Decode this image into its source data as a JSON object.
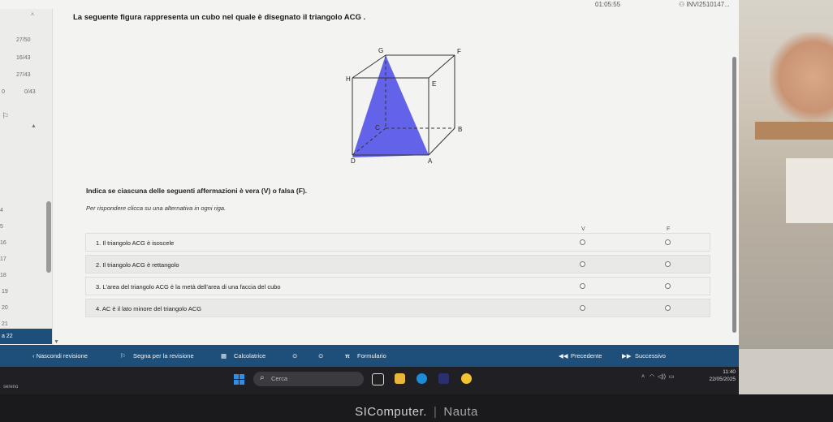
{
  "topbar": {
    "timer": "01:05:55",
    "user_id": "⚇ INVI2510147..."
  },
  "question": {
    "text": "La seguente figura rappresenta un cubo nel quale è disegnato il triangolo ACG .",
    "cube_labels": {
      "G": "G",
      "F": "F",
      "H": "H",
      "E": "E",
      "C": "C",
      "B": "B",
      "D": "D",
      "A": "A"
    },
    "triangle_color": "#5b5be8"
  },
  "sidebar": {
    "items": [
      {
        "label": "27/50"
      },
      {
        "label": "16/43"
      },
      {
        "label": "27/43"
      },
      {
        "label": "0/43",
        "prefix": "0"
      }
    ],
    "numbers": [
      "4",
      "5",
      "16",
      "17",
      "18",
      "19",
      "20",
      "21"
    ],
    "active": "a 22",
    "accent": "#1d4f7a"
  },
  "instructions": {
    "title": "Indica se ciascuna delle seguenti affermazioni è vera (V) o falsa (F).",
    "hint": "Per rispondere clicca su una alternativa in ogni riga."
  },
  "table": {
    "col_v": "V",
    "col_f": "F",
    "rows": [
      {
        "text": "1. Il triangolo ACG è isoscele"
      },
      {
        "text": "2. Il triangolo ACG è rettangolo"
      },
      {
        "text": "3. L'area del triangolo ACG è la metà dell'area di una faccia del cubo"
      },
      {
        "text": "4. AC è il lato minore del triangolo ACG"
      }
    ]
  },
  "navbar": {
    "hide_review": "‹  Nascondi revisione",
    "flag_review": "Segna per la revisione",
    "calculator": "Calcolatrice",
    "formulary": "Formulario",
    "previous": "Precedente",
    "next": "Successivo",
    "color": "#1d4f7a"
  },
  "taskbar": {
    "weather": "sereno",
    "search_placeholder": "Cerca",
    "time": "11:40",
    "date": "22/05/2025"
  },
  "brand": {
    "name": "SIComputer.",
    "model": "Nauta"
  }
}
